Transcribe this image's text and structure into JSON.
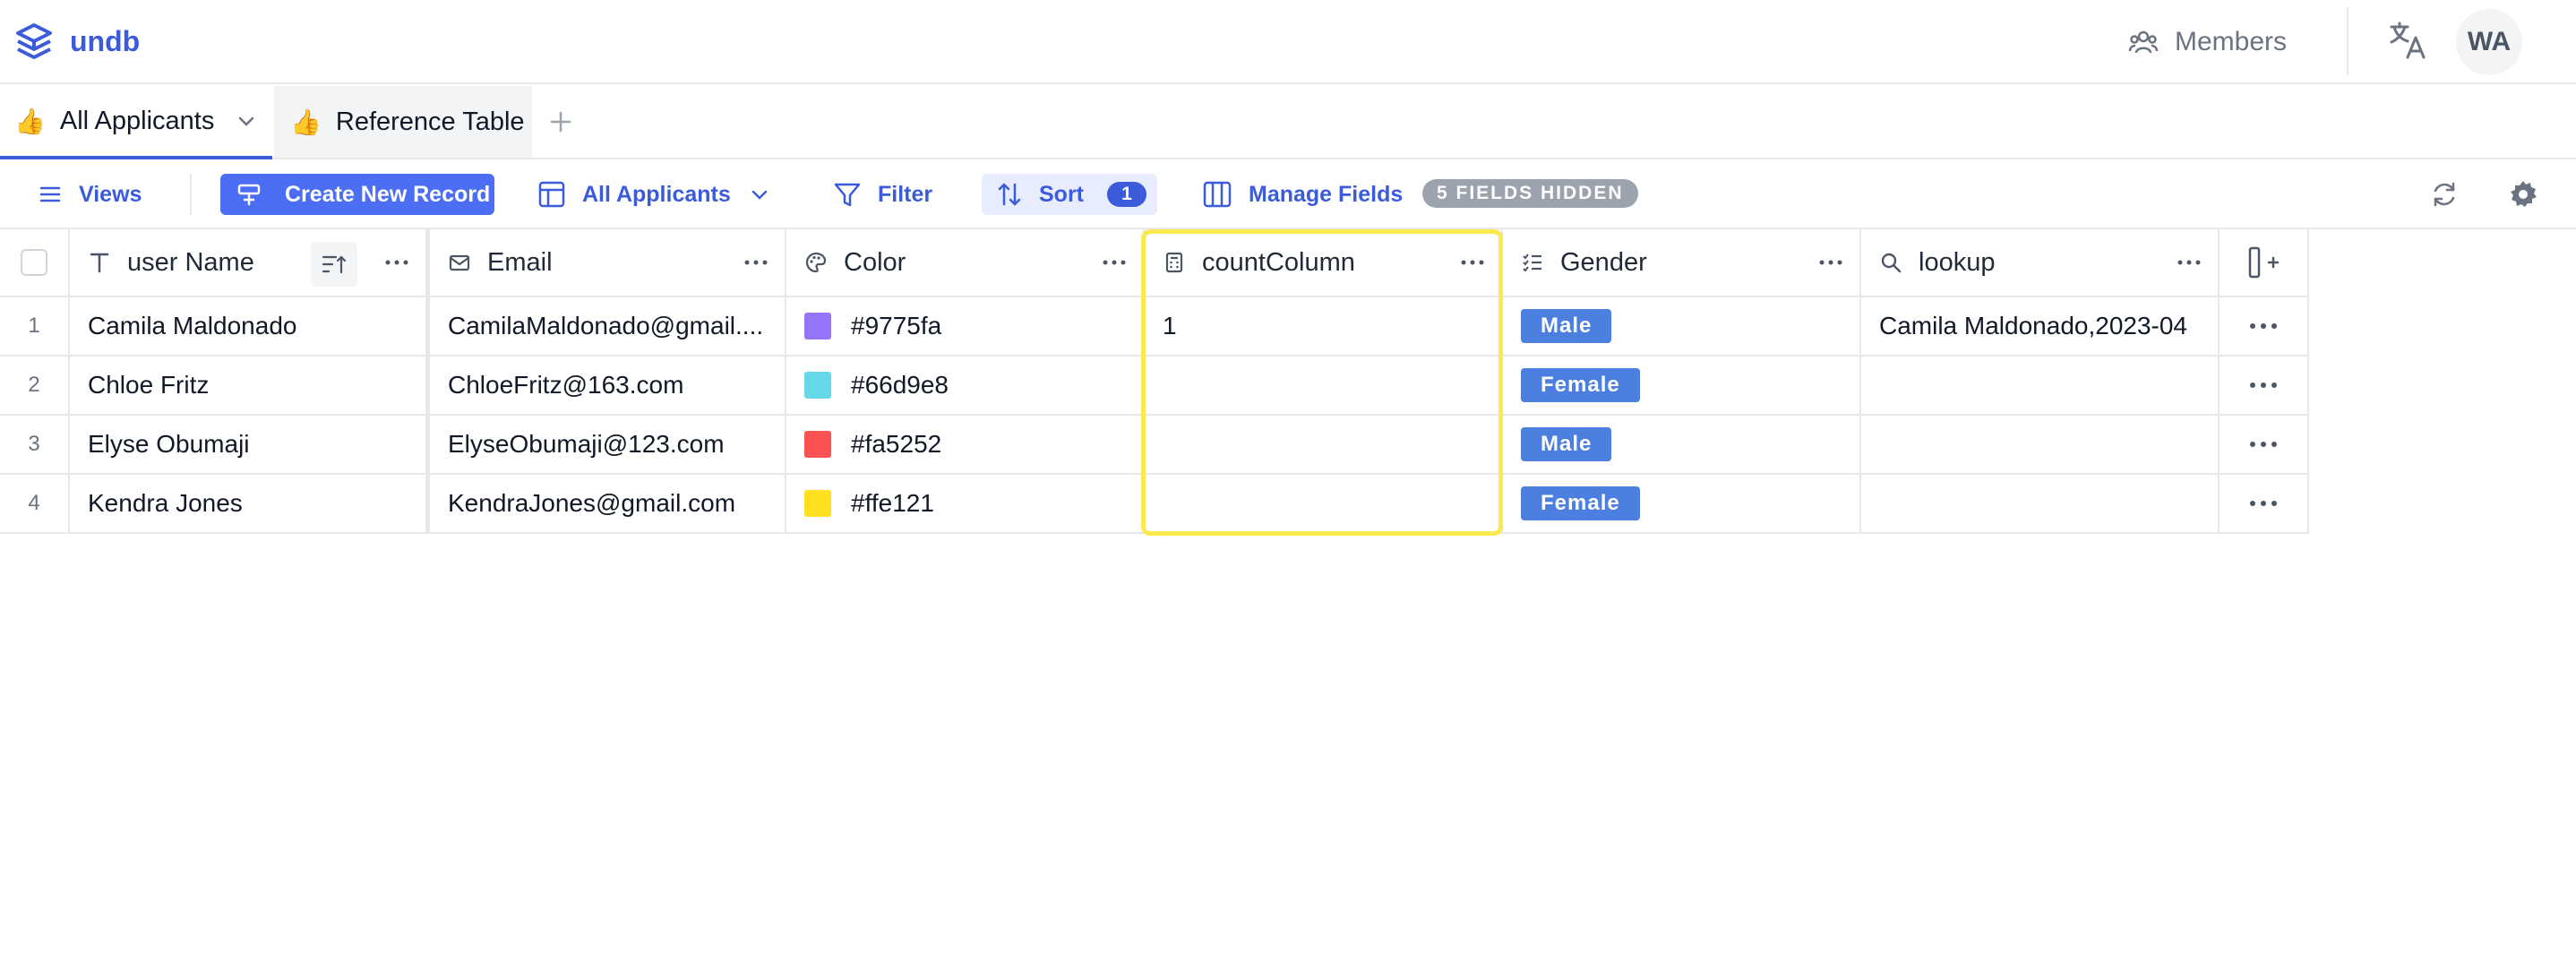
{
  "app": {
    "name": "undb"
  },
  "header": {
    "members_label": "Members",
    "avatar_initials": "WA"
  },
  "tabs": [
    {
      "emoji": "👍",
      "label": "All Applicants"
    },
    {
      "emoji": "👍",
      "label": "Reference Table"
    }
  ],
  "toolbar": {
    "views_label": "Views",
    "create_label": "Create New Record",
    "view_label": "All Applicants",
    "filter_label": "Filter",
    "sort_label": "Sort",
    "sort_count": "1",
    "manage_fields_label": "Manage Fields",
    "hidden_fields_label": "5 FIELDS HIDDEN"
  },
  "columns": [
    {
      "label": "user Name",
      "icon": "text-icon"
    },
    {
      "label": "Email",
      "icon": "mail-icon"
    },
    {
      "label": "Color",
      "icon": "palette-icon"
    },
    {
      "label": "countColumn",
      "icon": "calculator-icon"
    },
    {
      "label": "Gender",
      "icon": "list-check-icon"
    },
    {
      "label": "lookup",
      "icon": "search-icon"
    }
  ],
  "rows": [
    {
      "num": "1",
      "name": "Camila Maldonado",
      "email": "CamilaMaldonado@gmail....",
      "color": "#9775fa",
      "count": "1",
      "gender": "Male",
      "lookup": "Camila Maldonado,2023-04"
    },
    {
      "num": "2",
      "name": "Chloe Fritz",
      "email": "ChloeFritz@163.com",
      "color": "#66d9e8",
      "count": "",
      "gender": "Female",
      "lookup": ""
    },
    {
      "num": "3",
      "name": "Elyse Obumaji",
      "email": "ElyseObumaji@123.com",
      "color": "#fa5252",
      "count": "",
      "gender": "Male",
      "lookup": ""
    },
    {
      "num": "4",
      "name": "Kendra Jones",
      "email": "KendraJones@gmail.com",
      "color": "#ffe121",
      "count": "",
      "gender": "Female",
      "lookup": ""
    }
  ],
  "colors": {
    "accent": "#3b5bdb",
    "highlight": "#fce94f"
  }
}
